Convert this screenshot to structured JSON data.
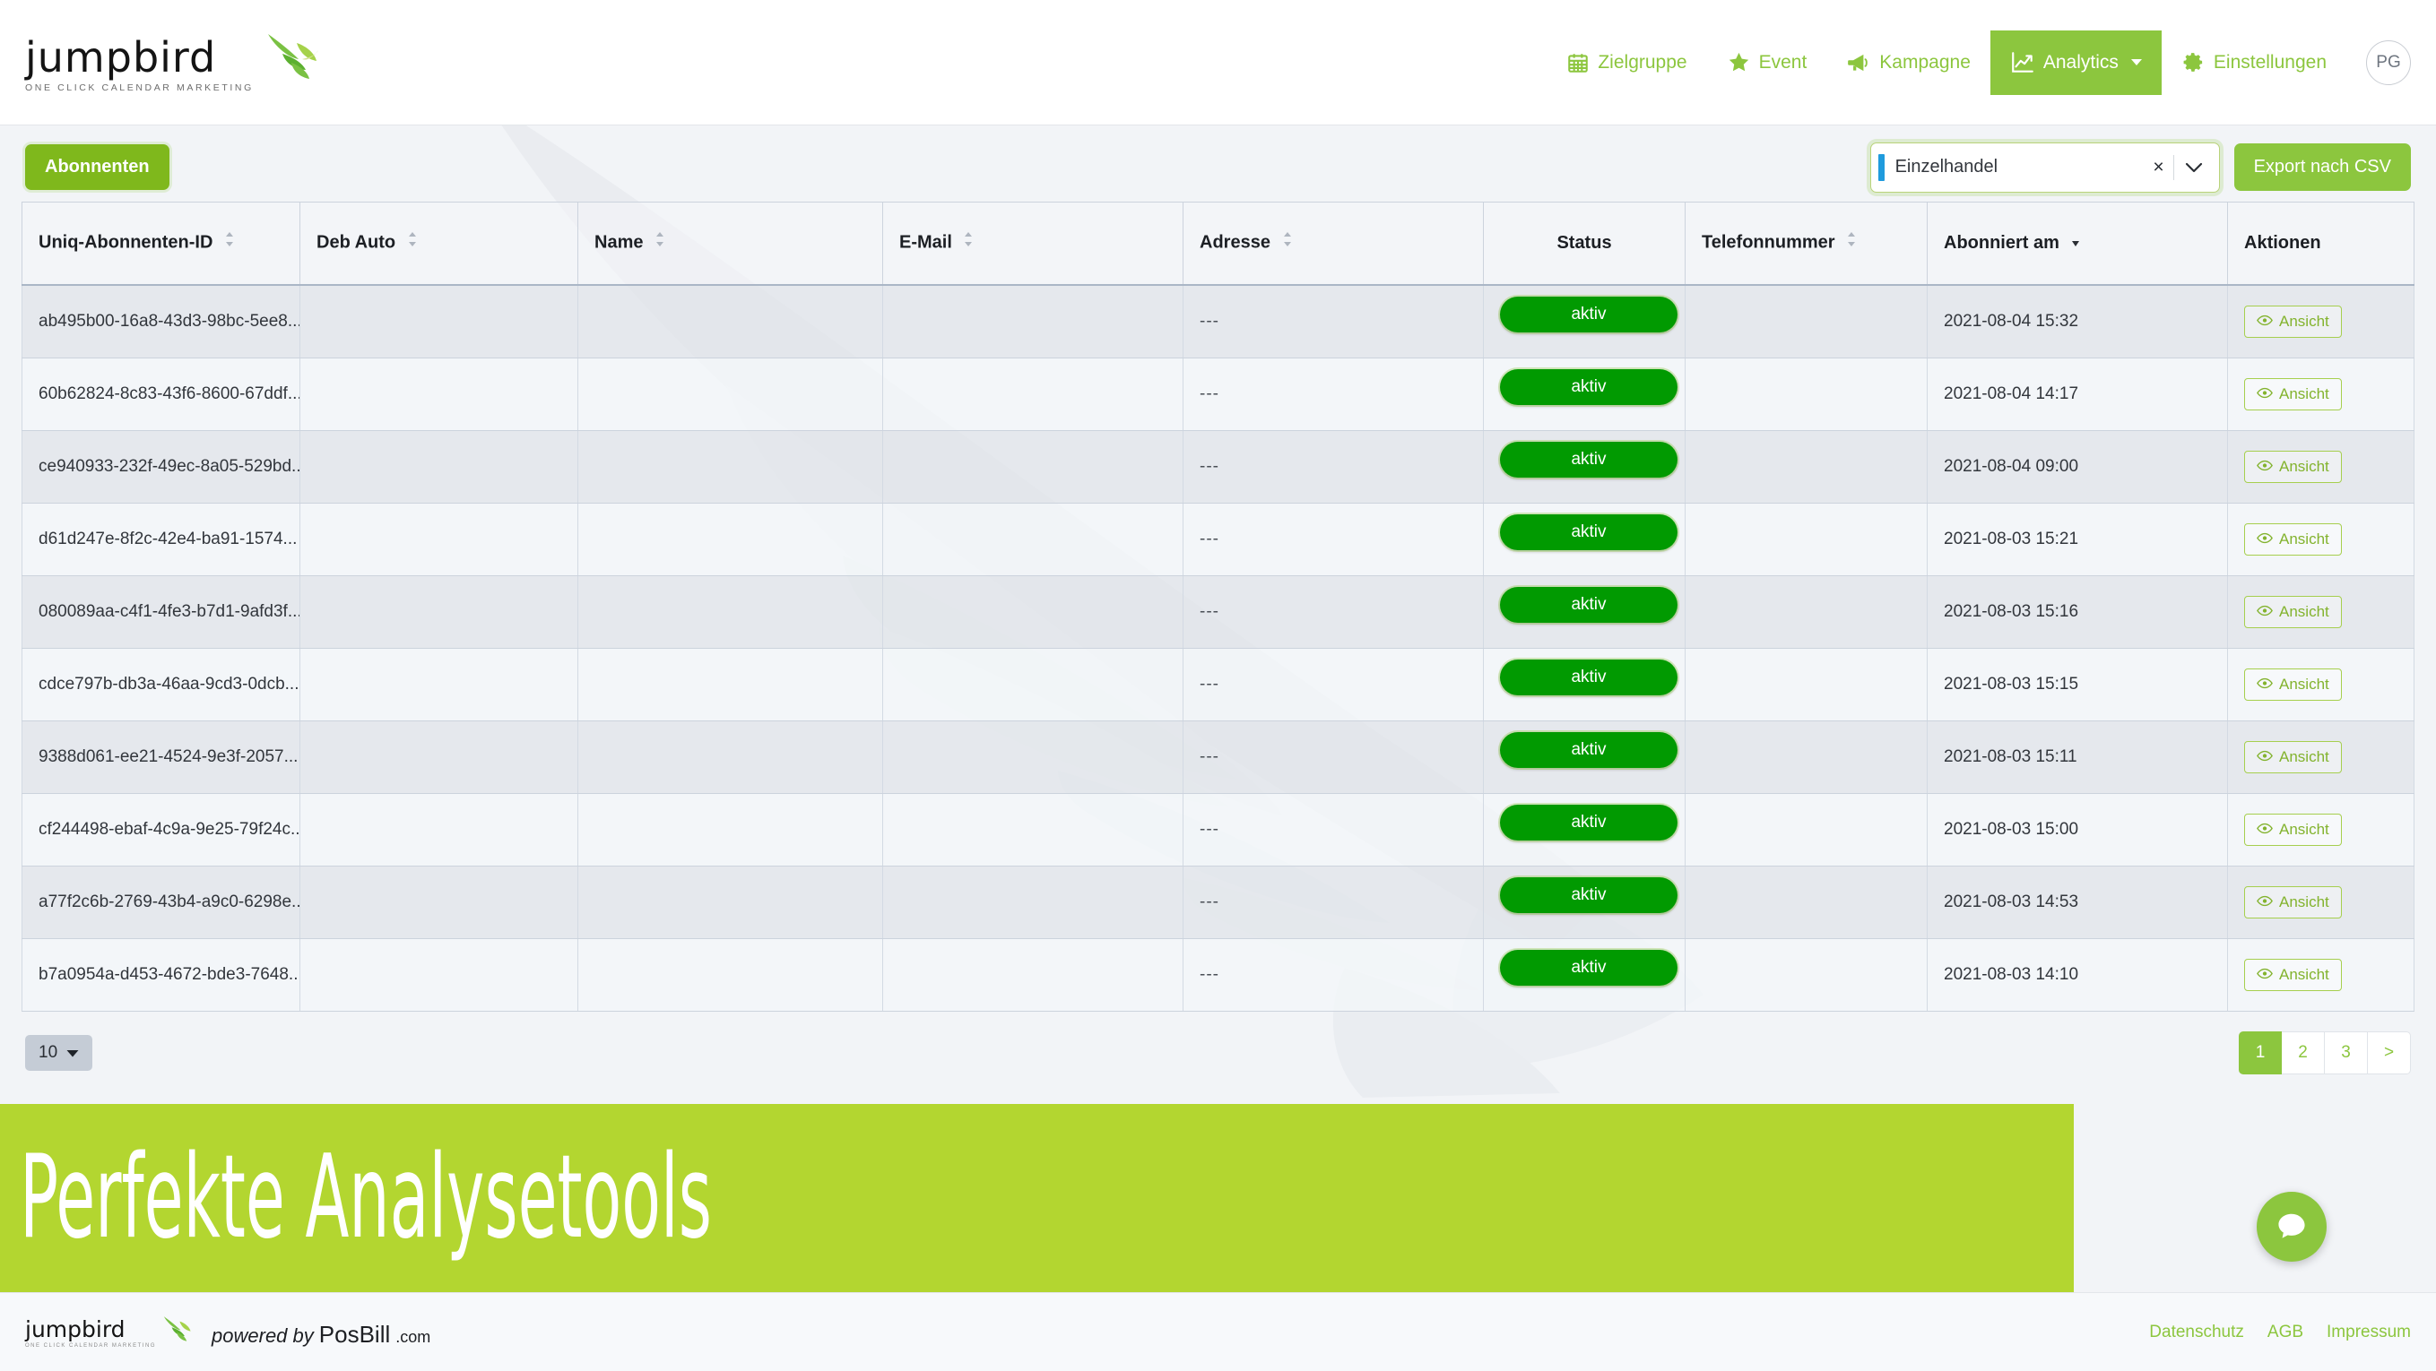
{
  "brand": {
    "logo_word": "jumpbird",
    "logo_tagline": "ONE CLICK CALENDAR MARKETING",
    "accent_green": "#8cc63e",
    "banner_green": "#b3d630",
    "status_green": "#019a01"
  },
  "nav": {
    "items": [
      {
        "label": "Zielgruppe",
        "icon": "calendar-icon",
        "active": false
      },
      {
        "label": "Event",
        "icon": "star-icon",
        "active": false
      },
      {
        "label": "Kampagne",
        "icon": "megaphone-icon",
        "active": false
      },
      {
        "label": "Analytics",
        "icon": "analytics-chart-icon",
        "active": true
      },
      {
        "label": "Einstellungen",
        "icon": "gear-icon",
        "active": false
      }
    ],
    "avatar_initials": "PG"
  },
  "toolbar": {
    "abonnenten_label": "Abonnenten",
    "filter_value": "Einzelhandel",
    "filter_clear_label": "×",
    "export_label": "Export nach CSV"
  },
  "table": {
    "columns": [
      {
        "label": "Uniq-Abonnenten-ID",
        "sortable": true,
        "sorted": "none",
        "align": "left"
      },
      {
        "label": "Deb Auto",
        "sortable": true,
        "sorted": "none",
        "align": "left"
      },
      {
        "label": "Name",
        "sortable": true,
        "sorted": "none",
        "align": "left"
      },
      {
        "label": "E-Mail",
        "sortable": true,
        "sorted": "none",
        "align": "left"
      },
      {
        "label": "Adresse",
        "sortable": true,
        "sorted": "none",
        "align": "left"
      },
      {
        "label": "Status",
        "sortable": false,
        "sorted": "none",
        "align": "center"
      },
      {
        "label": "Telefonnummer",
        "sortable": true,
        "sorted": "none",
        "align": "left"
      },
      {
        "label": "Abonniert am",
        "sortable": true,
        "sorted": "desc",
        "align": "left"
      },
      {
        "label": "Aktionen",
        "sortable": false,
        "sorted": "none",
        "align": "left"
      }
    ],
    "action_label": "Ansicht",
    "empty_value": "---",
    "rows": [
      {
        "id": "ab495b00-16a8-43d3-98bc-5ee8...",
        "deb_auto": "",
        "name": "",
        "email": "",
        "adresse": "---",
        "status": "aktiv",
        "telefon": "",
        "abonniert_am": "2021-08-04 15:32"
      },
      {
        "id": "60b62824-8c83-43f6-8600-67ddf...",
        "deb_auto": "",
        "name": "",
        "email": "",
        "adresse": "---",
        "status": "aktiv",
        "telefon": "",
        "abonniert_am": "2021-08-04 14:17"
      },
      {
        "id": "ce940933-232f-49ec-8a05-529bd...",
        "deb_auto": "",
        "name": "",
        "email": "",
        "adresse": "---",
        "status": "aktiv",
        "telefon": "",
        "abonniert_am": "2021-08-04 09:00"
      },
      {
        "id": "d61d247e-8f2c-42e4-ba91-1574...",
        "deb_auto": "",
        "name": "",
        "email": "",
        "adresse": "---",
        "status": "aktiv",
        "telefon": "",
        "abonniert_am": "2021-08-03 15:21"
      },
      {
        "id": "080089aa-c4f1-4fe3-b7d1-9afd3f...",
        "deb_auto": "",
        "name": "",
        "email": "",
        "adresse": "---",
        "status": "aktiv",
        "telefon": "",
        "abonniert_am": "2021-08-03 15:16"
      },
      {
        "id": "cdce797b-db3a-46aa-9cd3-0dcb...",
        "deb_auto": "",
        "name": "",
        "email": "",
        "adresse": "---",
        "status": "aktiv",
        "telefon": "",
        "abonniert_am": "2021-08-03 15:15"
      },
      {
        "id": "9388d061-ee21-4524-9e3f-2057...",
        "deb_auto": "",
        "name": "",
        "email": "",
        "adresse": "---",
        "status": "aktiv",
        "telefon": "",
        "abonniert_am": "2021-08-03 15:11"
      },
      {
        "id": "cf244498-ebaf-4c9a-9e25-79f24c...",
        "deb_auto": "",
        "name": "",
        "email": "",
        "adresse": "---",
        "status": "aktiv",
        "telefon": "",
        "abonniert_am": "2021-08-03 15:00"
      },
      {
        "id": "a77f2c6b-2769-43b4-a9c0-6298e...",
        "deb_auto": "",
        "name": "",
        "email": "",
        "adresse": "---",
        "status": "aktiv",
        "telefon": "",
        "abonniert_am": "2021-08-03 14:53"
      },
      {
        "id": "b7a0954a-d453-4672-bde3-7648...",
        "deb_auto": "",
        "name": "",
        "email": "",
        "adresse": "---",
        "status": "aktiv",
        "telefon": "",
        "abonniert_am": "2021-08-03 14:10"
      }
    ]
  },
  "pager": {
    "page_size": "10",
    "pages": [
      "1",
      "2",
      "3",
      ">"
    ],
    "active_page": "1"
  },
  "banner": {
    "headline": "Perfekte Analysetools"
  },
  "footer": {
    "logo_word": "jumpbird",
    "logo_tagline": "ONE CLICK CALENDAR MARKETING",
    "powered_prefix": "powered by",
    "powered_brand": "PosBill",
    "powered_tld": ".com",
    "links": [
      "Datenschutz",
      "AGB",
      "Impressum"
    ]
  }
}
